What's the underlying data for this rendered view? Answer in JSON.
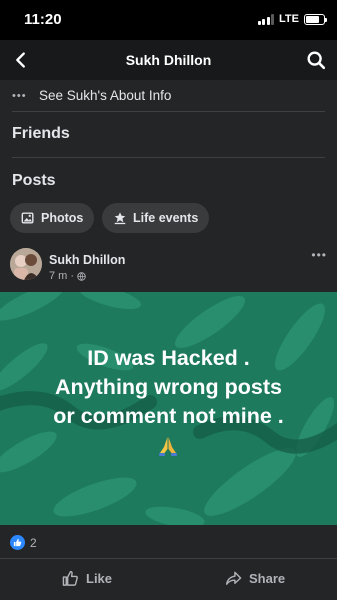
{
  "status_bar": {
    "time": "11:20",
    "network": "LTE",
    "signal_bars_active": 3,
    "battery_level": 0.75
  },
  "nav": {
    "title": "Sukh Dhillon",
    "back_icon": "chevron-left-icon",
    "search_icon": "search-icon"
  },
  "profile": {
    "about_label": "See Sukh's About Info",
    "friends_heading": "Friends",
    "posts_heading": "Posts",
    "chips": [
      {
        "label": "Photos",
        "icon": "photos-icon"
      },
      {
        "label": "Life events",
        "icon": "star-flag-icon"
      }
    ]
  },
  "post": {
    "author": "Sukh Dhillon",
    "timestamp": "7 m",
    "separator": "·",
    "privacy_icon": "globe-icon",
    "text_lines": [
      "ID was Hacked .",
      "Anything wrong posts",
      "or comment not mine ."
    ],
    "emoji": "folded-hands-icon",
    "reaction_count": "2",
    "actions": {
      "like": "Like",
      "share": "Share"
    }
  },
  "colors": {
    "panel": "#242526",
    "nav": "#18191a",
    "post_background": "#1d7a5c",
    "accent": "#2d88ff"
  }
}
